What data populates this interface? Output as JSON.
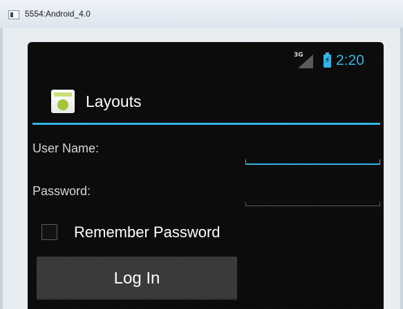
{
  "window": {
    "title": "5554:Android_4.0"
  },
  "statusbar": {
    "network": "3G",
    "battery_icon": "battery-charging-icon",
    "time": "2:20"
  },
  "actionbar": {
    "title": "Layouts",
    "icon": "android-app-icon"
  },
  "form": {
    "username_label": "User Name:",
    "username_value": "",
    "password_label": "Password:",
    "password_value": "",
    "remember_label": "Remember Password",
    "remember_checked": false,
    "login_label": "Log In"
  },
  "colors": {
    "accent": "#33b5e5",
    "background": "#0a0a0a",
    "button": "#3a3a3a"
  }
}
